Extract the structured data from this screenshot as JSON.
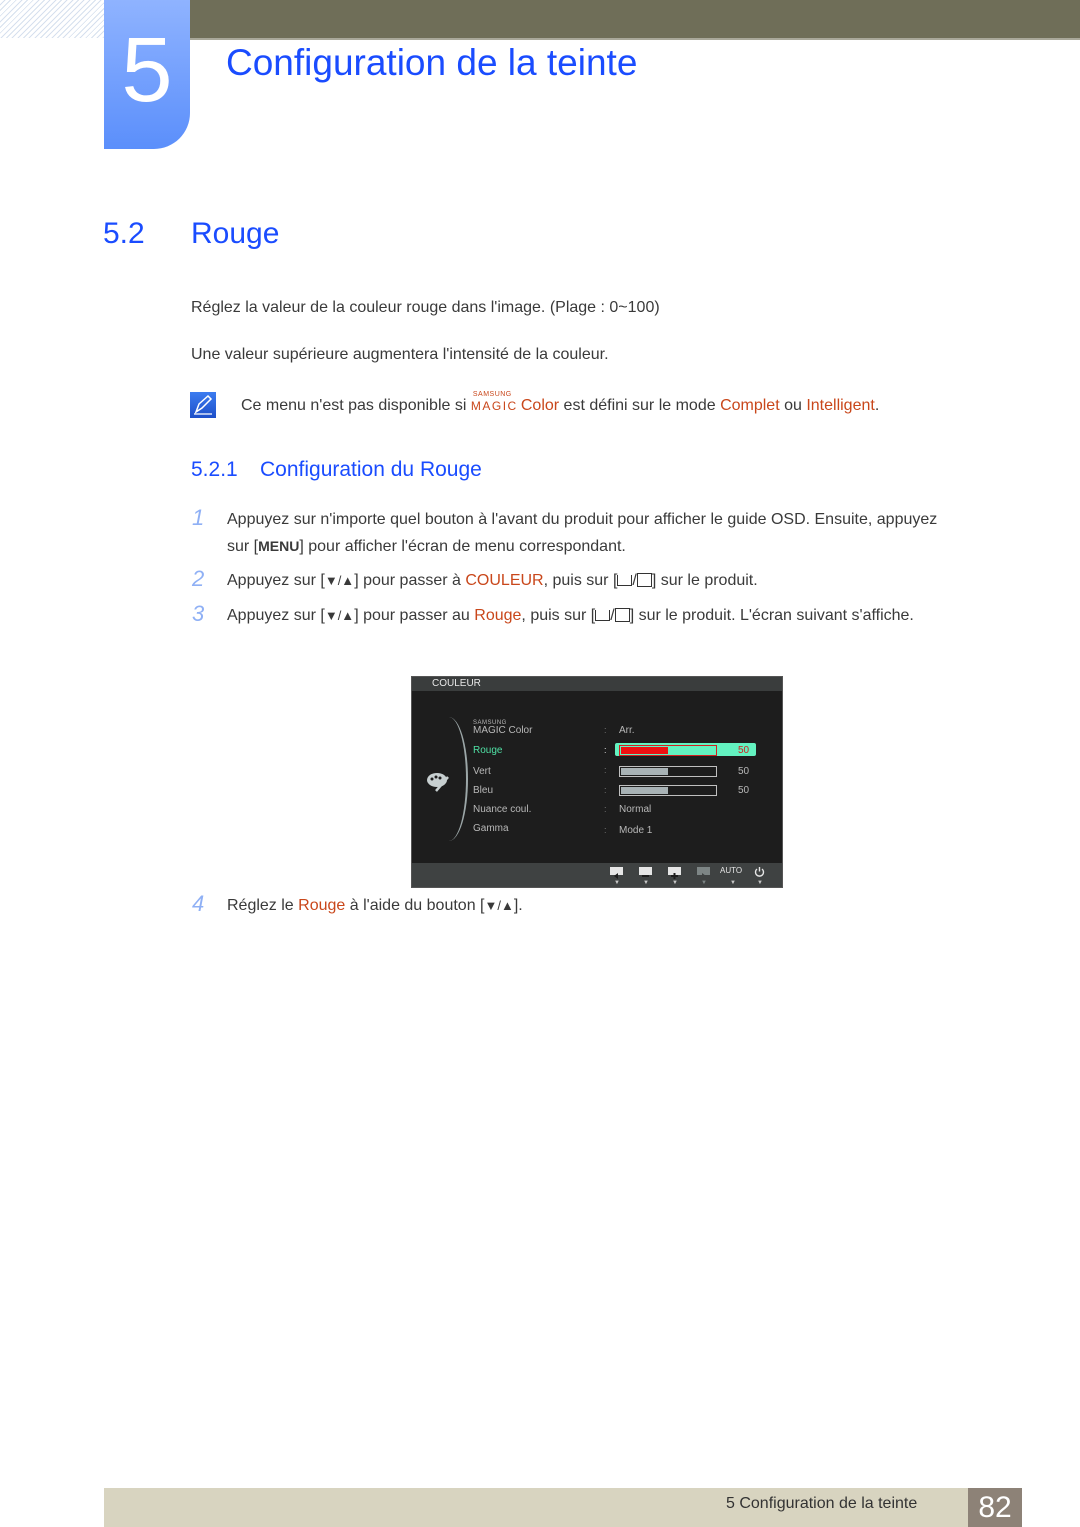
{
  "header": {
    "chapter_number": "5",
    "chapter_title": "Configuration de la teinte"
  },
  "section": {
    "number": "5.2",
    "title": "Rouge",
    "paragraphs": [
      "Réglez la valeur de la couleur rouge dans l'image. (Plage : 0~100)",
      "Une valeur supérieure augmentera l'intensité de la couleur."
    ],
    "note": {
      "icon": "note-pen-icon",
      "prefix": "Ce menu n'est pas disponible si ",
      "magic_top": "SAMSUNG",
      "magic_bottom": "MAGIC",
      "magic_word": "Color",
      "middle": " est défini sur le mode ",
      "option1": "Complet",
      "connector": " ou ",
      "option2": "Intelligent",
      "suffix": "."
    }
  },
  "subsection": {
    "number": "5.2.1",
    "title": "Configuration du Rouge"
  },
  "steps": [
    {
      "num": "1",
      "t1": "Appuyez sur n'importe quel bouton à l'avant du produit pour afficher le guide OSD. Ensuite, appuyez sur [",
      "key": "MENU",
      "t2": "] pour afficher l'écran de menu correspondant."
    },
    {
      "num": "2",
      "t1": "Appuyez sur [",
      "arrows": "▼/▲",
      "t2": "] pour passer à ",
      "highlight": "COULEUR",
      "t3": ", puis sur [",
      "t4": "] sur le produit."
    },
    {
      "num": "3",
      "t1": "Appuyez sur [",
      "arrows": "▼/▲",
      "t2": "] pour passer au ",
      "highlight": "Rouge",
      "t3": ", puis sur [",
      "t4": "] sur le produit. L'écran suivant s'affiche."
    },
    {
      "num": "4",
      "t1": "Réglez le ",
      "highlight": "Rouge",
      "t2": " à l'aide du bouton [",
      "arrows": "▼/▲",
      "t3": "]."
    }
  ],
  "osd": {
    "title": "COULEUR",
    "rows": [
      {
        "label_top": "SAMSUNG",
        "label": "MAGIC Color",
        "value": "Arr."
      },
      {
        "label": "Rouge",
        "value_pct": 50,
        "number": "50",
        "active": true
      },
      {
        "label": "Vert",
        "value_pct": 50,
        "number": "50"
      },
      {
        "label": "Bleu",
        "value_pct": 50,
        "number": "50"
      },
      {
        "label": "Nuance coul.",
        "value": "Normal"
      },
      {
        "label": "Gamma",
        "value": "Mode 1"
      }
    ],
    "footer_buttons": [
      "left-arrow",
      "minus",
      "plus",
      "right-arrow",
      "AUTO",
      "power"
    ],
    "auto_label": "AUTO"
  },
  "footer": {
    "text": "5 Configuration de la teinte",
    "page": "82"
  }
}
